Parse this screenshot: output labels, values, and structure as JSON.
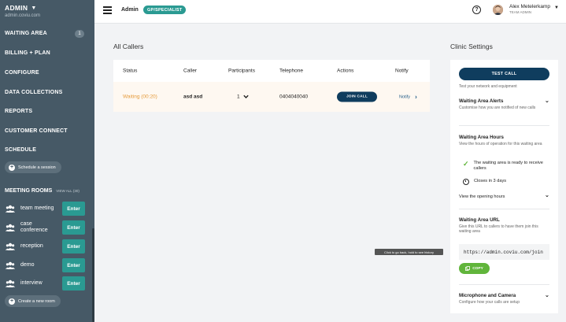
{
  "sidebar": {
    "org_title": "ADMIN",
    "org_domain": "admin.coviu.com",
    "nav": [
      {
        "label": "WAITING AREA",
        "badge": "1"
      },
      {
        "label": "BILLING + PLAN"
      },
      {
        "label": "CONFIGURE"
      },
      {
        "label": "DATA COLLECTIONS"
      },
      {
        "label": "REPORTS"
      },
      {
        "label": "CUSTOMER CONNECT"
      },
      {
        "label": "SCHEDULE"
      }
    ],
    "schedule_button": "Schedule a session",
    "meeting_rooms_title": "MEETING ROOMS",
    "view_all": "VIEW ALL (30)",
    "rooms": [
      {
        "name": "team meeting",
        "enter": "Enter"
      },
      {
        "name": "case conference",
        "enter": "Enter"
      },
      {
        "name": "reception",
        "enter": "Enter"
      },
      {
        "name": "demo",
        "enter": "Enter"
      },
      {
        "name": "interview",
        "enter": "Enter"
      }
    ],
    "create_room_button": "Create a new room"
  },
  "topbar": {
    "section": "Admin",
    "role_badge": "GP/SPECIALIST",
    "help": "?",
    "user_name": "Alex Metelerkamp",
    "user_role": "TEAM ADMIN"
  },
  "callers": {
    "title": "All Callers",
    "headers": [
      "Status",
      "Caller",
      "Participants",
      "Telephone",
      "Actions",
      "Notify"
    ],
    "rows": [
      {
        "status": "Waiting (00:20)",
        "caller": "asd asd",
        "participants": "1",
        "telephone": "0404040040",
        "action": "JOIN CALL",
        "notify": "Notify"
      }
    ]
  },
  "tooltip": "Click to go back, hold to see history",
  "clinic": {
    "title": "Clinic Settings",
    "test_call": "TEST CALL",
    "test_desc": "Test your network and equipment",
    "alerts_title": "Waiting Area Alerts",
    "alerts_desc": "Customise how you are notified of new calls",
    "hours_title": "Waiting Area Hours",
    "hours_desc": "View the hours of operation for this waiting area",
    "ready_text": "The waiting area is ready to receive callers",
    "closes_text": "Closes in 3 days",
    "opening_hours_link": "View the opening hours",
    "url_title": "Waiting Area URL",
    "url_desc": "Give this URL to callers to have them join this waiting area",
    "url_value": "https://admin.coviu.com/join",
    "copy": "COPY",
    "mic_title": "Microphone and Camera",
    "mic_desc": "Configure how your calls are setup"
  },
  "colors": {
    "sidebar_bg": "#465966",
    "accent_teal": "#2a9a92",
    "primary_navy": "#0f3d5e",
    "waiting_orange": "#e59a3a",
    "success_green": "#61b53b"
  }
}
